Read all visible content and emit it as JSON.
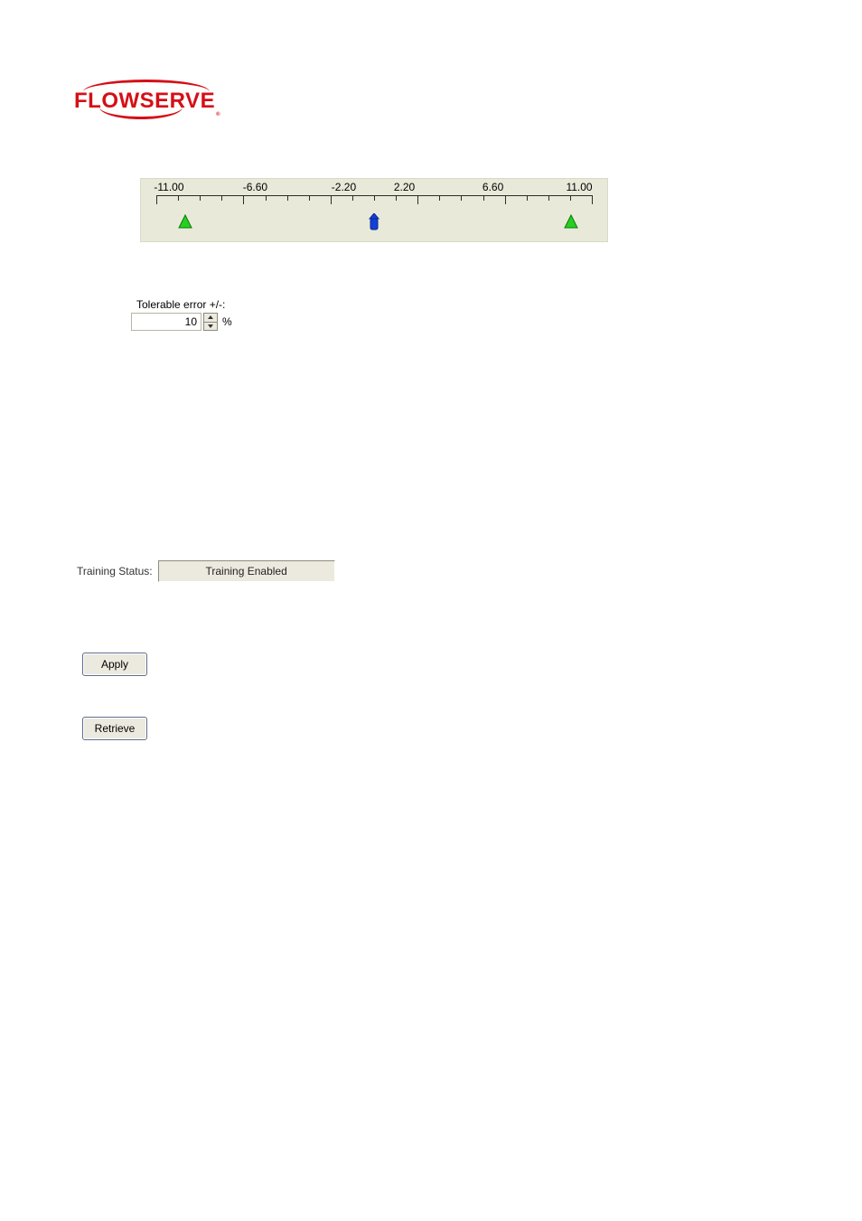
{
  "logo": {
    "text": "FLOWSERVE"
  },
  "scale": {
    "labels": [
      "-11.00",
      "-6.60",
      "-2.20",
      "2.20",
      "6.60",
      "11.00"
    ],
    "label_positions_pct": [
      6,
      24.5,
      43.5,
      56.5,
      75.5,
      94
    ],
    "marker_blue_pct": 50,
    "marker_green_left_pct": 6.6,
    "marker_green_right_pct": 95.2
  },
  "tolerable_error": {
    "label": "Tolerable error +/-:",
    "value": "10",
    "unit": "%"
  },
  "training": {
    "label": "Training Status:",
    "value": "Training Enabled"
  },
  "buttons": {
    "apply": "Apply",
    "retrieve": "Retrieve"
  }
}
